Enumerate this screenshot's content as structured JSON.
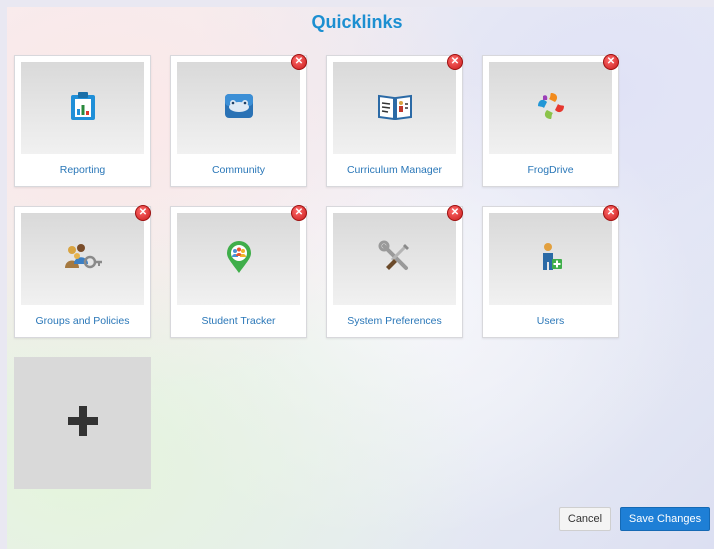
{
  "title": "Quicklinks",
  "tiles": [
    {
      "label": "Reporting",
      "icon": "clipboard-chart-icon",
      "removable": false
    },
    {
      "label": "Community",
      "icon": "frog-mask-icon",
      "removable": true
    },
    {
      "label": "Curriculum Manager",
      "icon": "open-book-icon",
      "removable": true
    },
    {
      "label": "FrogDrive",
      "icon": "frogdrive-logo-icon",
      "removable": true
    },
    {
      "label": "Groups and Policies",
      "icon": "people-key-icon",
      "removable": true
    },
    {
      "label": "Student Tracker",
      "icon": "map-pin-people-icon",
      "removable": true
    },
    {
      "label": "System Preferences",
      "icon": "tools-icon",
      "removable": true
    },
    {
      "label": "Users",
      "icon": "add-user-icon",
      "removable": true
    }
  ],
  "remove_glyph": "✕",
  "add_glyph": "+",
  "buttons": {
    "cancel": "Cancel",
    "save": "Save Changes"
  },
  "colors": {
    "title": "#1c8fd1",
    "label": "#2a77b8",
    "save": "#1e7fd6",
    "remove": "#d62626"
  }
}
